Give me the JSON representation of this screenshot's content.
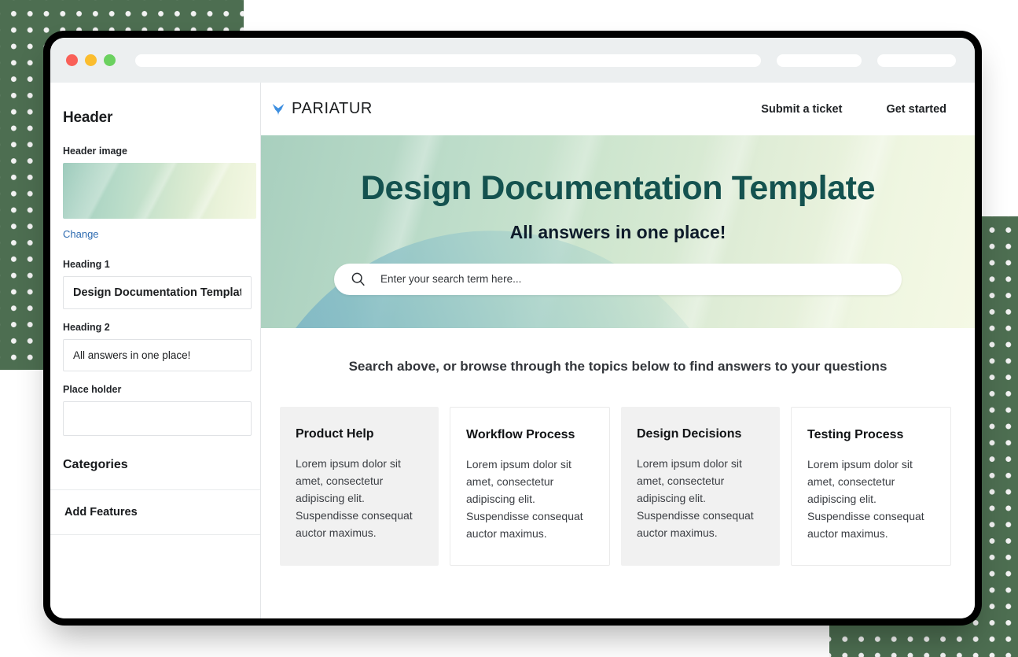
{
  "window": {
    "traffic_lights": [
      "close",
      "minimize",
      "maximize"
    ],
    "colors": {
      "close": "#f96058",
      "minimize": "#fbbd2e",
      "maximize": "#6bd15f"
    }
  },
  "sidebar": {
    "title": "Header",
    "fields": [
      {
        "label": "Header image",
        "type": "image",
        "action_label": "Change"
      },
      {
        "label": "Heading 1",
        "type": "text",
        "value": "Design Documentation Template",
        "placeholder": ""
      },
      {
        "label": "Heading 2",
        "type": "text",
        "value": "All answers in one place!",
        "placeholder": ""
      },
      {
        "label": "Place holder",
        "type": "text",
        "value": "",
        "placeholder": ""
      }
    ],
    "section_title": "Categories",
    "rows": [
      {
        "label": "Add Features"
      }
    ]
  },
  "site": {
    "brand": {
      "name": "PARIATUR",
      "icon": "leaf-logo-icon",
      "color": "#3e8fe0"
    },
    "nav_links": [
      {
        "label": "Submit a ticket"
      },
      {
        "label": "Get started"
      }
    ],
    "hero": {
      "heading_1": "Design Documentation Template",
      "heading_2": "All answers in one place!",
      "heading_1_color": "#14524f",
      "search": {
        "icon": "search-icon",
        "placeholder": "Enter your search term here...",
        "value": ""
      },
      "gradient_from": "#a8cfbe",
      "gradient_to": "#f5f9e5"
    },
    "browse_line": "Search above, or browse through the topics below to find answers to your questions",
    "cards": [
      {
        "title": "Product Help",
        "body": "Lorem ipsum dolor sit amet, consectetur adipiscing elit. Suspendisse consequat auctor maximus.",
        "style": "filled"
      },
      {
        "title": "Workflow Process",
        "body": "Lorem ipsum dolor sit amet, consectetur adipiscing elit. Suspendisse consequat auctor maximus.",
        "style": "outlined"
      },
      {
        "title": "Design Decisions",
        "body": "Lorem ipsum dolor sit amet, consectetur adipiscing elit. Suspendisse consequat auctor maximus.",
        "style": "filled"
      },
      {
        "title": "Testing Process",
        "body": "Lorem ipsum dolor sit amet, consectetur adipiscing elit. Suspendisse consequat auctor maximus.",
        "style": "outlined"
      }
    ]
  },
  "background": {
    "color": "#4d6e51",
    "dot_color": "#f2f2f2"
  }
}
